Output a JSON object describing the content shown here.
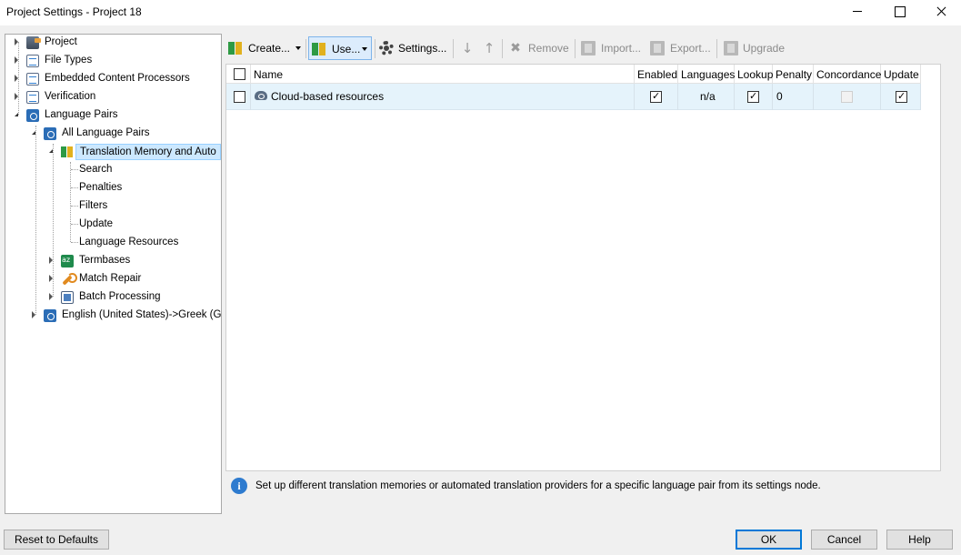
{
  "window": {
    "title": "Project Settings - Project 18"
  },
  "tree": {
    "items": [
      {
        "label": "Project",
        "icon": "project-icon"
      },
      {
        "label": "File Types",
        "icon": "file-types-icon"
      },
      {
        "label": "Embedded Content Processors",
        "icon": "embedded-content-icon"
      },
      {
        "label": "Verification",
        "icon": "verification-icon"
      },
      {
        "label": "Language Pairs",
        "icon": "language-pairs-icon"
      },
      {
        "label": "All Language Pairs",
        "icon": "language-pair-icon"
      },
      {
        "label": "Translation Memory and Auto",
        "icon": "translation-memory-icon"
      },
      {
        "label": "Search"
      },
      {
        "label": "Penalties"
      },
      {
        "label": "Filters"
      },
      {
        "label": "Update"
      },
      {
        "label": "Language Resources"
      },
      {
        "label": "Termbases",
        "icon": "termbase-icon"
      },
      {
        "label": "Match Repair",
        "icon": "wrench-icon"
      },
      {
        "label": "Batch Processing",
        "icon": "batch-icon"
      },
      {
        "label": "English (United States)->Greek (Gr",
        "icon": "language-pair-icon"
      }
    ]
  },
  "toolbar": {
    "create": "Create...",
    "use": "Use...",
    "settings": "Settings...",
    "remove": "Remove",
    "import": "Import...",
    "export": "Export...",
    "upgrade": "Upgrade"
  },
  "grid": {
    "columns": [
      "Name",
      "Enabled",
      "Languages",
      "Lookup",
      "Penalty",
      "Concordance",
      "Update"
    ],
    "rows": [
      {
        "name": "Cloud-based resources",
        "enabled": true,
        "languages": "n/a",
        "lookup": true,
        "penalty": "0",
        "concordance": false,
        "update": true
      }
    ]
  },
  "info": {
    "text": "Set up different translation memories or automated translation providers for a specific language pair from its settings node."
  },
  "buttons": {
    "reset": "Reset to Defaults",
    "ok": "OK",
    "cancel": "Cancel",
    "help": "Help"
  },
  "colors": {
    "selection": "#cce8ff",
    "row_highlight": "#e5f3fb",
    "accent": "#0078d7"
  }
}
